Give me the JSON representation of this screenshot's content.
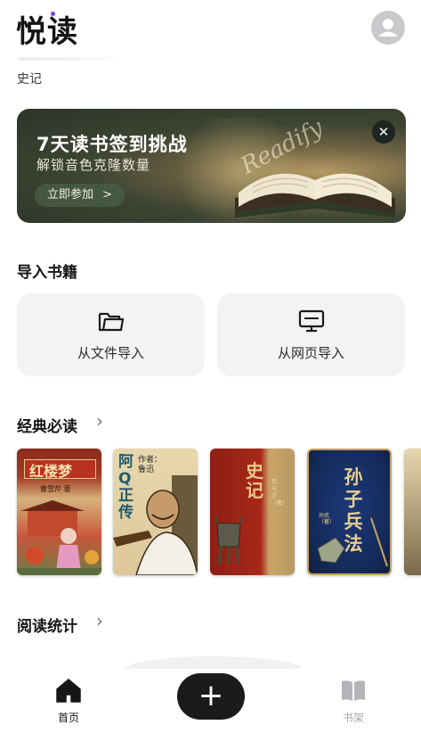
{
  "header": {
    "app_title": "悦读",
    "recent_label": "史记"
  },
  "banner": {
    "title": "7天读书签到挑战",
    "subtitle": "解锁音色克隆数量",
    "cta_label": "立即参加",
    "cta_arrow": ">",
    "close_label": "✕",
    "script_text": "Readify"
  },
  "import_section": {
    "title": "导入书籍",
    "items": [
      {
        "label": "从文件导入",
        "icon": "folder-icon"
      },
      {
        "label": "从网页导入",
        "icon": "monitor-icon"
      }
    ]
  },
  "classics": {
    "title": "经典必读",
    "chevron": "›",
    "books": [
      {
        "title": "红楼梦",
        "author": "曹雪芹 著"
      },
      {
        "title": "阿Q正传",
        "author": "作者：鲁迅"
      },
      {
        "title": "史记",
        "author": "司马迁（著）"
      },
      {
        "title": "孙子兵法",
        "author": "孙武（著）"
      }
    ]
  },
  "stats": {
    "title": "阅读统计",
    "chevron": "›"
  },
  "bottom_nav": {
    "home_label": "首页",
    "add_label": "+",
    "shelf_label": "书架"
  },
  "colors": {
    "accent": "#7b3fe4",
    "fab": "#1b1b1b",
    "card_bg": "#f3f3f6"
  }
}
